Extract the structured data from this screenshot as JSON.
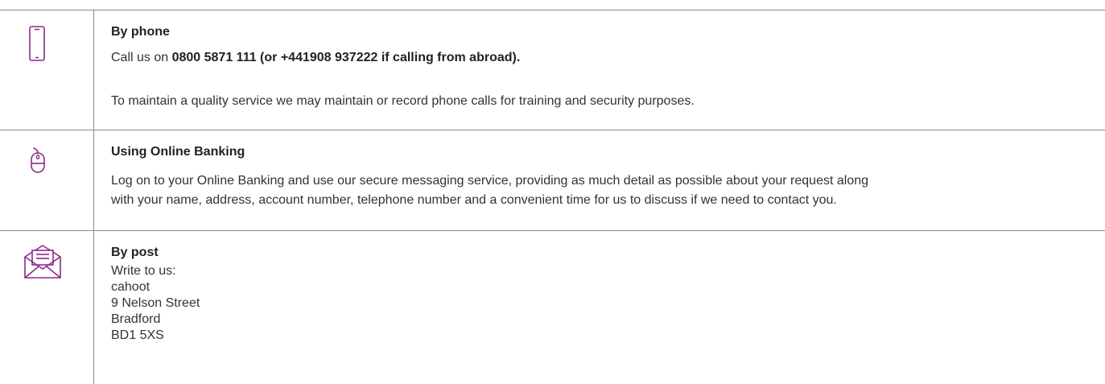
{
  "colors": {
    "accent": "#8a2a8c",
    "divider": "#8a8a8a",
    "text": "#333333"
  },
  "rows": {
    "phone": {
      "icon": "mobile-phone-icon",
      "title": "By phone",
      "call_prefix": "Call us on ",
      "call_number": "0800 5871 111 (or +441908 937222 if calling from abroad).",
      "note": "To maintain a quality service we may maintain or record phone calls for training and security purposes."
    },
    "online": {
      "icon": "computer-mouse-icon",
      "title": "Using Online Banking",
      "line1": "Log on to your Online Banking and use our secure messaging service, providing as much detail as possible about your request along",
      "line2": "with your name, address, account number, telephone number and a convenient time for us to discuss if we need to contact you."
    },
    "post": {
      "icon": "envelope-letter-icon",
      "title": "By post",
      "intro": "Write to us:",
      "address": [
        "cahoot",
        "9 Nelson Street",
        "Bradford",
        "BD1 5XS"
      ]
    }
  }
}
